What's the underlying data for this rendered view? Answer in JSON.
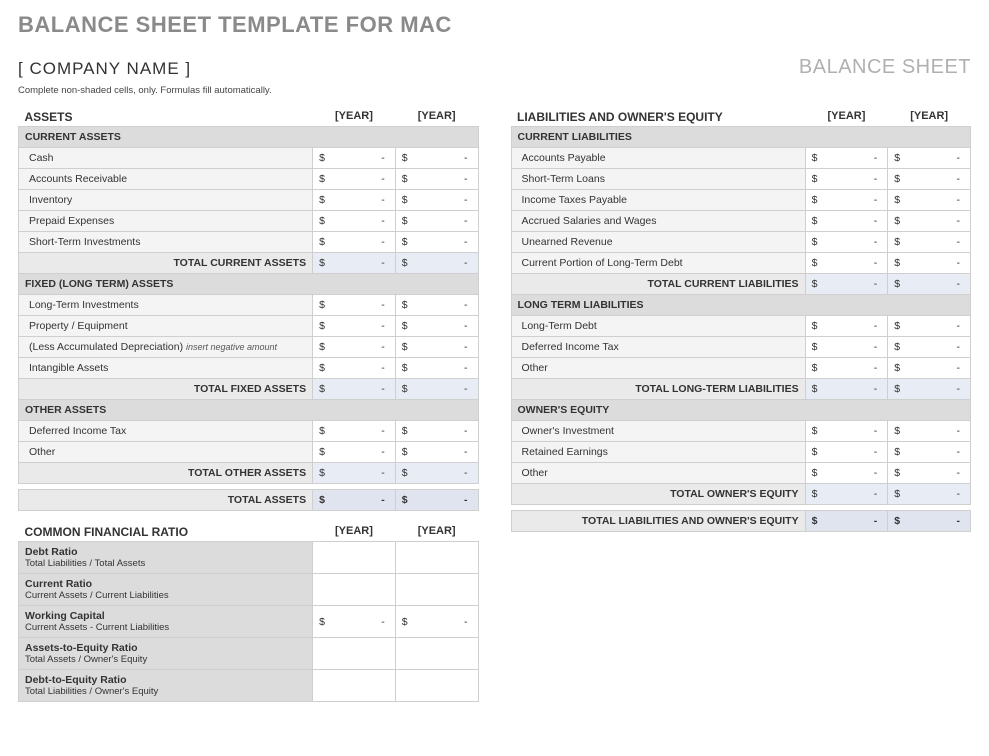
{
  "page_title": "BALANCE SHEET TEMPLATE FOR MAC",
  "company": "[ COMPANY NAME ]",
  "sheet_label": "BALANCE SHEET",
  "instruction": "Complete non-shaded cells, only.  Formulas fill automatically.",
  "year1": "[YEAR]",
  "year2": "[YEAR]",
  "currency": "$",
  "dash": "-",
  "assets": {
    "title": "ASSETS",
    "current": {
      "hdr": "CURRENT ASSETS",
      "rows": [
        "Cash",
        "Accounts Receivable",
        "Inventory",
        "Prepaid Expenses",
        "Short-Term Investments"
      ],
      "total": "TOTAL CURRENT ASSETS"
    },
    "fixed": {
      "hdr": "FIXED (LONG TERM) ASSETS",
      "rows": [
        "Long-Term Investments",
        "Property / Equipment",
        "(Less Accumulated Depreciation)",
        "Intangible Assets"
      ],
      "note": "insert negative amount",
      "total": "TOTAL FIXED ASSETS"
    },
    "other": {
      "hdr": "OTHER ASSETS",
      "rows": [
        "Deferred Income Tax",
        "Other"
      ],
      "total": "TOTAL OTHER ASSETS"
    },
    "grand": "TOTAL ASSETS"
  },
  "liab": {
    "title": "LIABILITIES AND OWNER'S EQUITY",
    "current": {
      "hdr": "CURRENT LIABILITIES",
      "rows": [
        "Accounts Payable",
        "Short-Term Loans",
        "Income Taxes Payable",
        "Accrued Salaries and Wages",
        "Unearned Revenue",
        "Current Portion of Long-Term Debt"
      ],
      "total": "TOTAL CURRENT LIABILITIES"
    },
    "longterm": {
      "hdr": "LONG TERM LIABILITIES",
      "rows": [
        "Long-Term Debt",
        "Deferred Income Tax",
        "Other"
      ],
      "total": "TOTAL LONG-TERM LIABILITIES"
    },
    "equity": {
      "hdr": "OWNER'S EQUITY",
      "rows": [
        "Owner's Investment",
        "Retained Earnings",
        "Other"
      ],
      "total": "TOTAL OWNER'S EQUITY"
    },
    "grand": "TOTAL LIABILITIES AND OWNER'S EQUITY"
  },
  "ratios": {
    "title": "COMMON FINANCIAL RATIO",
    "rows": [
      {
        "name": "Debt Ratio",
        "desc": "Total Liabilities / Total Assets",
        "money": false
      },
      {
        "name": "Current Ratio",
        "desc": "Current Assets / Current Liabilities",
        "money": false
      },
      {
        "name": "Working Capital",
        "desc": "Current Assets - Current Liabilities",
        "money": true
      },
      {
        "name": "Assets-to-Equity Ratio",
        "desc": "Total Assets / Owner's Equity",
        "money": false
      },
      {
        "name": "Debt-to-Equity Ratio",
        "desc": "Total Liabilities / Owner's Equity",
        "money": false
      }
    ]
  }
}
